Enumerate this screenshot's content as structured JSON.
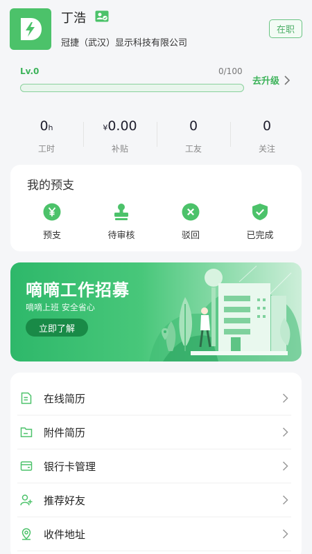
{
  "profile": {
    "name": "丁浩",
    "company": "冠捷（武汉）显示科技有限公司",
    "status": "在职"
  },
  "level": {
    "label": "Lv.0",
    "progress_text": "0/100",
    "progress_fraction": 0,
    "upgrade_label": "去升级"
  },
  "stats": [
    {
      "value": "0",
      "unit": "h",
      "label": "工时"
    },
    {
      "value": "0.00",
      "prefix": "¥",
      "label": "补贴"
    },
    {
      "value": "0",
      "label": "工友"
    },
    {
      "value": "0",
      "label": "关注"
    }
  ],
  "advance": {
    "title": "我的预支",
    "items": [
      {
        "label": "预支",
        "icon": "yen-icon"
      },
      {
        "label": "待审核",
        "icon": "stamp-icon"
      },
      {
        "label": "驳回",
        "icon": "close-circle-icon"
      },
      {
        "label": "已完成",
        "icon": "shield-check-icon"
      }
    ]
  },
  "banner": {
    "title": "嘀嘀工作招募",
    "subtitle": "嘀嘀上班  安全省心",
    "button": "立即了解"
  },
  "menu": [
    {
      "label": "在线简历",
      "icon": "document-icon"
    },
    {
      "label": "附件简历",
      "icon": "folder-icon"
    },
    {
      "label": "银行卡管理",
      "icon": "card-icon"
    },
    {
      "label": "推荐好友",
      "icon": "add-user-icon"
    },
    {
      "label": "收件地址",
      "icon": "location-icon"
    }
  ],
  "colors": {
    "brand_green": "#4cc26a",
    "accent_green": "#3db35a"
  }
}
